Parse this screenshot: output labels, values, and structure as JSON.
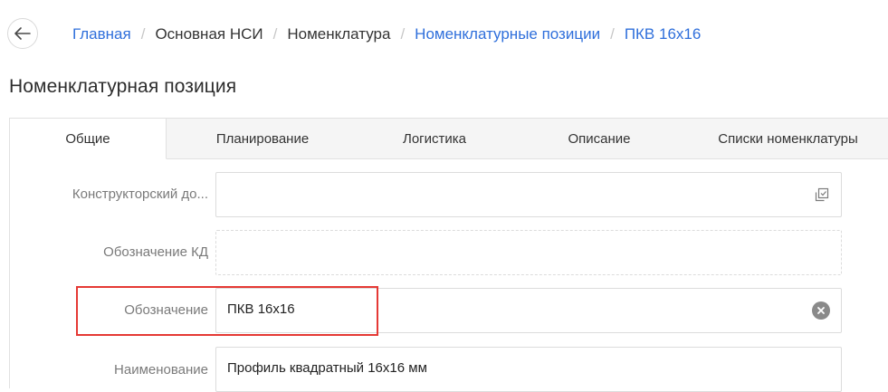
{
  "breadcrumb": {
    "items": [
      {
        "label": "Главная",
        "link": true
      },
      {
        "label": "Основная НСИ",
        "link": false
      },
      {
        "label": "Номенклатура",
        "link": false
      },
      {
        "label": "Номенклатурные позиции",
        "link": true
      },
      {
        "label": "ПКВ 16x16",
        "link": true
      }
    ],
    "separator": "/"
  },
  "page_title": "Номенклатурная позиция",
  "tabs": [
    {
      "label": "Общие",
      "active": true
    },
    {
      "label": "Планирование",
      "active": false
    },
    {
      "label": "Логистика",
      "active": false
    },
    {
      "label": "Описание",
      "active": false
    },
    {
      "label": "Списки номенклатуры",
      "active": false
    }
  ],
  "form": {
    "design_doc": {
      "label": "Конструкторский до...",
      "value": ""
    },
    "kd_designation": {
      "label": "Обозначение КД",
      "value": ""
    },
    "designation": {
      "label": "Обозначение",
      "value": "ПКВ 16x16"
    },
    "name": {
      "label": "Наименование",
      "value": "Профиль квадратный 16x16 мм"
    }
  },
  "colors": {
    "link": "#2f6fdb",
    "highlight": "#e53935",
    "tab_inactive_bg": "#f5f5f5"
  },
  "icons": {
    "back": "arrow-left-icon",
    "picker": "open-in-dialog-icon",
    "clear": "clear-circle-icon"
  }
}
